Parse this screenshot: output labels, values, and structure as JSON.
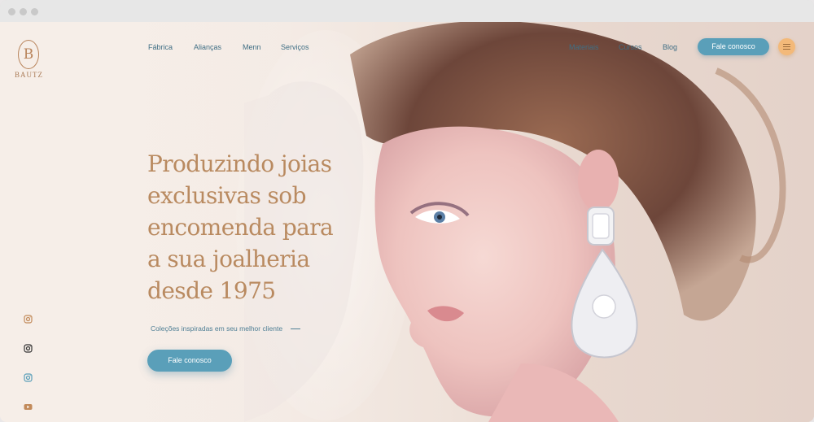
{
  "logo": {
    "mark": "B",
    "text": "BAUTZ"
  },
  "nav_left": [
    {
      "label": "Fábrica"
    },
    {
      "label": "Alianças"
    },
    {
      "label": "Menn"
    },
    {
      "label": "Serviços"
    }
  ],
  "nav_right": [
    {
      "label": "Materiais"
    },
    {
      "label": "Cursos"
    },
    {
      "label": "Blog"
    }
  ],
  "header": {
    "cta_label": "Fale conosco"
  },
  "hero": {
    "headline_lines": [
      "Produzindo joias",
      "exclusivas sob",
      "encomenda para",
      "a sua joalheria",
      "desde 1975"
    ],
    "tagline": "Coleções inspiradas em seu melhor cliente",
    "cta_label": "Fale conosco"
  },
  "social": [
    {
      "icon": "instagram-icon",
      "color": "#c28a5a"
    },
    {
      "icon": "instagram-icon",
      "color": "#333333"
    },
    {
      "icon": "instagram-icon",
      "color": "#5a9fb9"
    },
    {
      "icon": "youtube-icon",
      "color": "#c28a5a"
    }
  ],
  "colors": {
    "accent_blue": "#5a9fb9",
    "accent_gold": "#b98a60",
    "menu_orange": "#f3b979"
  }
}
